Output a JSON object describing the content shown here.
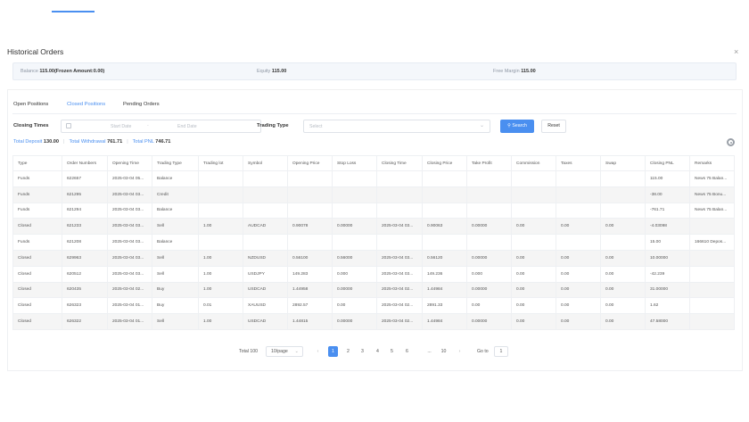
{
  "dialog": {
    "title": "Historical Orders",
    "close": "×"
  },
  "account": {
    "balance_label": "Balance",
    "balance_value": "115.00(Frozen Amount:0.00)",
    "equity_label": "Equity",
    "equity_value": "115.00",
    "free_margin_label": "Free Margin",
    "free_margin_value": "115.00"
  },
  "tabs": [
    {
      "label": "Open Positions"
    },
    {
      "label": "Closed Positions",
      "active": true
    },
    {
      "label": "Pending Orders"
    }
  ],
  "filters": {
    "closing_times_label": "Closing Times",
    "start_placeholder": "Start Date",
    "separator": "-",
    "end_placeholder": "End Date",
    "trading_type_label": "Trading Type",
    "select_placeholder": "Select",
    "search_label": "Search",
    "reset_label": "Reset"
  },
  "totals": {
    "deposit_label": "Total Deposit",
    "deposit_value": "130.00",
    "withdrawal_label": "Total Withdrawal",
    "withdrawal_value": "761.71",
    "pnl_label": "Total PNL",
    "pnl_value": "746.71"
  },
  "table": {
    "columns": [
      "Type",
      "Order Numbers",
      "Opening Time",
      "Trading Type",
      "Trading lot",
      "Symbol",
      "Opening Price",
      "Stop Loss",
      "Closing Time",
      "Closing Price",
      "Take Profit",
      "Commission",
      "Taxes",
      "Swap",
      "Closing PNL",
      "Remarks"
    ],
    "rows": [
      [
        "Funds",
        "622657",
        "2025-03-04 05...",
        "Balance",
        "",
        "",
        "",
        "",
        "",
        "",
        "",
        "",
        "",
        "",
        "115.00",
        "News 75 Balan..."
      ],
      [
        "Funds",
        "621295",
        "2025-03-04 03...",
        "Credit",
        "",
        "",
        "",
        "",
        "",
        "",
        "",
        "",
        "",
        "",
        "-38.00",
        "News 75 Bonu..."
      ],
      [
        "Funds",
        "621294",
        "2025-03-04 03...",
        "Balance",
        "",
        "",
        "",
        "",
        "",
        "",
        "",
        "",
        "",
        "",
        "-761.71",
        "News 75 Balan..."
      ],
      [
        "Closed",
        "621233",
        "2025-03-04 03...",
        "Sell",
        "1.00",
        "AUDCAD",
        "0.90078",
        "0.00000",
        "2025-03-04 03...",
        "0.90063",
        "0.00000",
        "0.00",
        "0.00",
        "0.00",
        "-4.03098",
        ""
      ],
      [
        "Funds",
        "621208",
        "2025-03-04 03...",
        "Balance",
        "",
        "",
        "",
        "",
        "",
        "",
        "",
        "",
        "",
        "",
        "15.00",
        "166610 Depos..."
      ],
      [
        "Closed",
        "629963",
        "2025-03-04 03...",
        "Sell",
        "1.00",
        "NZDUSD",
        "0.56100",
        "0.56000",
        "2025-03-04 03...",
        "0.56120",
        "0.00000",
        "0.00",
        "0.00",
        "0.00",
        "10.00000",
        ""
      ],
      [
        "Closed",
        "620512",
        "2025-03-04 03...",
        "Sell",
        "1.00",
        "USDJPY",
        "149.283",
        "0.000",
        "2025-03-04 03...",
        "149.236",
        "0.000",
        "0.00",
        "0.00",
        "0.00",
        "-42.239",
        ""
      ],
      [
        "Closed",
        "620435",
        "2025-03-04 02...",
        "Buy",
        "1.00",
        "USDCAD",
        "1.44958",
        "0.00000",
        "2025-03-04 02...",
        "1.44984",
        "0.00000",
        "0.00",
        "0.00",
        "0.00",
        "31.00000",
        ""
      ],
      [
        "Closed",
        "626323",
        "2025-03-04 01...",
        "Buy",
        "0.01",
        "XAUUSD",
        "2892.57",
        "0.00",
        "2025-03-04 02...",
        "2891.33",
        "0.00",
        "0.00",
        "0.00",
        "0.00",
        "1.62",
        ""
      ],
      [
        "Closed",
        "626322",
        "2025-03-04 01...",
        "Sell",
        "1.00",
        "USDCAD",
        "1.44815",
        "0.00000",
        "2025-03-04 02...",
        "1.44984",
        "0.00000",
        "0.00",
        "0.00",
        "0.00",
        "47.58000",
        ""
      ]
    ]
  },
  "pagination": {
    "total": "Total 100",
    "page_size": "10/page",
    "prev": "‹",
    "pages": [
      "1",
      "2",
      "3",
      "4",
      "5",
      "6",
      "...",
      "10"
    ],
    "next": "›",
    "goto_label": "Go to",
    "goto_value": "1"
  }
}
